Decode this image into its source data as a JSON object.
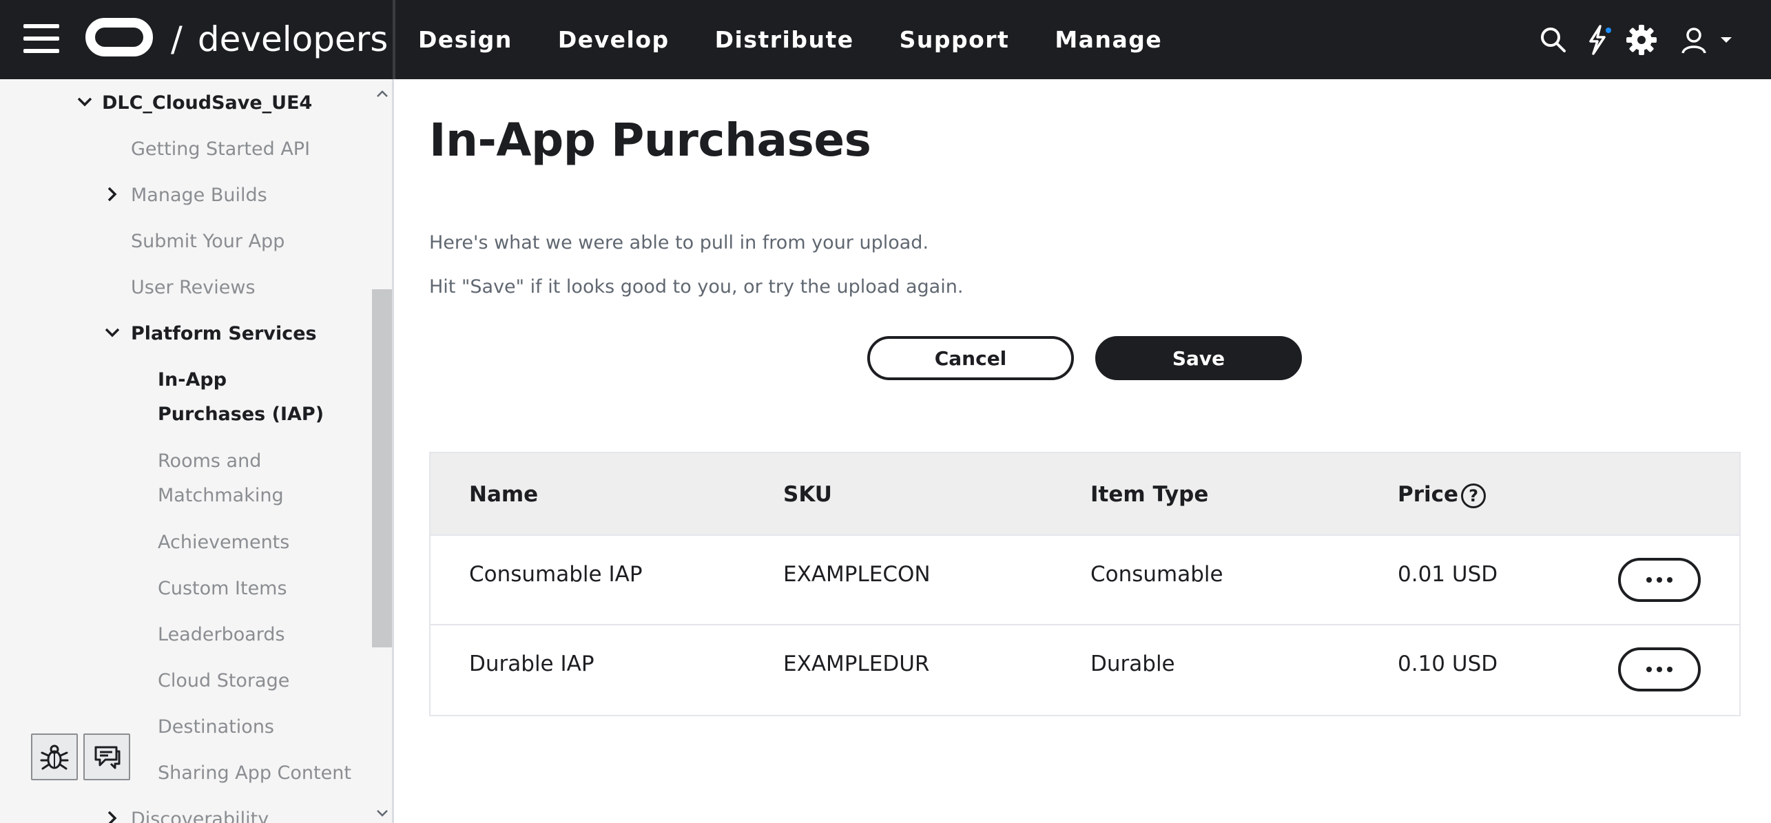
{
  "header": {
    "brand": "developers",
    "brand_separator": "/",
    "nav": [
      {
        "label": "Design"
      },
      {
        "label": "Develop"
      },
      {
        "label": "Distribute"
      },
      {
        "label": "Support"
      },
      {
        "label": "Manage"
      }
    ],
    "icons": [
      "search-icon",
      "lightning-icon",
      "gear-icon",
      "user-icon",
      "caret-down-icon"
    ],
    "accent_dot_color": "#1b8eff"
  },
  "sidebar": {
    "app": "DLC_CloudSave_UE4",
    "items": [
      {
        "label": "Getting Started API"
      },
      {
        "label": "Manage Builds"
      },
      {
        "label": "Submit Your App"
      },
      {
        "label": "User Reviews"
      },
      {
        "label": "Platform Services"
      },
      {
        "label": "In-App Purchases (IAP)"
      },
      {
        "label": "Rooms and Matchmaking"
      },
      {
        "label": "Achievements"
      },
      {
        "label": "Custom Items"
      },
      {
        "label": "Leaderboards"
      },
      {
        "label": "Cloud Storage"
      },
      {
        "label": "Destinations"
      },
      {
        "label": "Sharing App Content"
      },
      {
        "label": "Discoverability"
      }
    ],
    "utility_icons": [
      "bug-icon",
      "feedback-icon"
    ]
  },
  "main": {
    "title": "In-App Purchases",
    "desc1": "Here's what we were able to pull in from your upload.",
    "desc2": "Hit \"Save\" if it looks good to you, or try the upload again.",
    "cancel_label": "Cancel",
    "save_label": "Save",
    "table": {
      "headers": {
        "name": "Name",
        "sku": "SKU",
        "type": "Item Type",
        "price": "Price"
      },
      "rows": [
        {
          "name": "Consumable IAP",
          "sku": "EXAMPLECON",
          "type": "Consumable",
          "price": "0.01 USD"
        },
        {
          "name": "Durable IAP",
          "sku": "EXAMPLEDUR",
          "type": "Durable",
          "price": "0.10 USD"
        }
      ]
    }
  }
}
